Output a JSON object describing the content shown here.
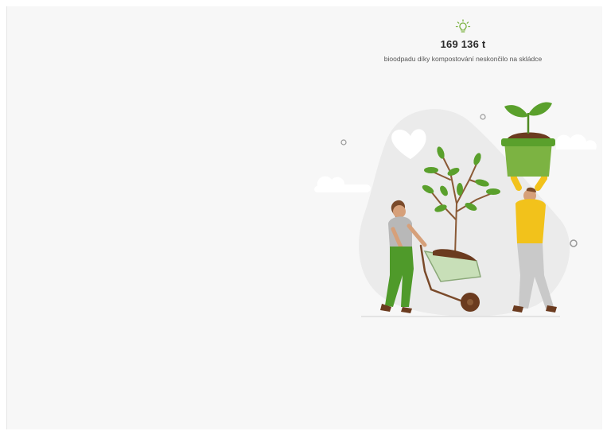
{
  "stat": {
    "icon": "lightbulb-icon",
    "value": "169 136 t",
    "caption": "bioodpadu díky kompostování neskončilo na skládce",
    "accent_color": "#7cb342"
  },
  "illustration": {
    "icon": "composting-illustration",
    "colors": {
      "leaf": "#5aa02c",
      "pot": "#7cb342",
      "shirt_yellow": "#f2c21b",
      "pants_green": "#4f9a2a",
      "soil": "#6b3b1f",
      "blob": "#ebebeb"
    }
  }
}
